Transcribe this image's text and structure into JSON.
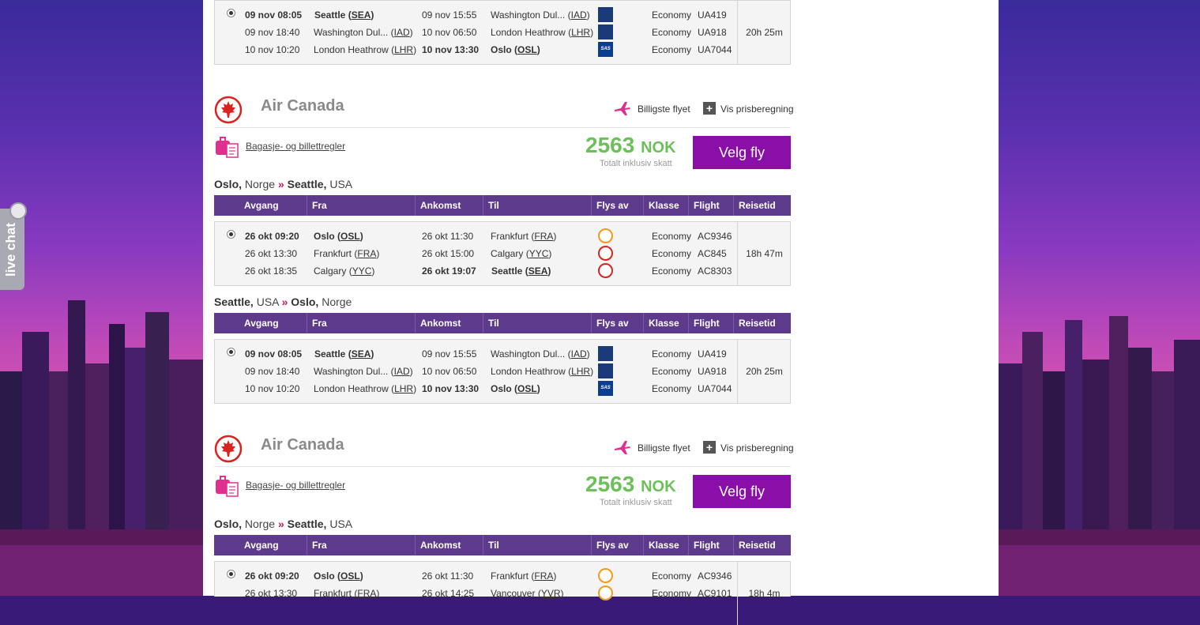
{
  "live_chat_label": "live chat",
  "header_labels": [
    "Avgang",
    "Fra",
    "Ankomst",
    "Til",
    "Flys av",
    "Klasse",
    "Flight",
    "Reisetid"
  ],
  "top_itinerary": {
    "duration": "20h 25m",
    "rows": [
      {
        "dep": "09 nov 08:05",
        "from": "Seattle",
        "from_code": "SEA",
        "arr": "09 nov 15:55",
        "to": "Washington Dul...",
        "to_code": "IAD",
        "carrier": "united-icon",
        "class": "Economy",
        "flight": "UA419",
        "bold_dep": true,
        "bold_arr": false
      },
      {
        "dep": "09 nov 18:40",
        "from": "Washington Dul...",
        "from_code": "IAD",
        "arr": "10 nov 06:50",
        "to": "London Heathrow",
        "to_code": "LHR",
        "carrier": "united-icon",
        "class": "Economy",
        "flight": "UA918",
        "bold_dep": false,
        "bold_arr": false
      },
      {
        "dep": "10 nov 10:20",
        "from": "London Heathrow",
        "from_code": "LHR",
        "arr": "10 nov 13:30",
        "to": "Oslo",
        "to_code": "OSL",
        "carrier": "sas-icon",
        "class": "Economy",
        "flight": "UA7044",
        "bold_dep": false,
        "bold_arr": true
      }
    ]
  },
  "offer1": {
    "airline": "Air Canada",
    "cheapest_label": "Billigste flyet",
    "show_price_label": "Vis prisberegning",
    "baggage_label": "Bagasje- og billettregler",
    "price": "2563",
    "currency": "NOK",
    "price_note": "Totalt inklusiv skatt",
    "select_label": "Velg fly",
    "out_route": {
      "from_city": "Oslo",
      "from_country": "Norge",
      "sep": "»",
      "to_city": "Seattle",
      "to_country": "USA"
    },
    "out_itinerary": {
      "duration": "18h 47m",
      "rows": [
        {
          "dep": "26 okt 09:20",
          "from": "Oslo",
          "from_code": "OSL",
          "arr": "26 okt 11:30",
          "to": "Frankfurt",
          "to_code": "FRA",
          "carrier": "lufthansa-icon",
          "class": "Economy",
          "flight": "AC9346",
          "bold_dep": true,
          "bold_arr": false
        },
        {
          "dep": "26 okt 13:30",
          "from": "Frankfurt",
          "from_code": "FRA",
          "arr": "26 okt 15:00",
          "to": "Calgary",
          "to_code": "YYC",
          "carrier": "air-canada-icon",
          "class": "Economy",
          "flight": "AC845",
          "bold_dep": false,
          "bold_arr": false
        },
        {
          "dep": "26 okt 18:35",
          "from": "Calgary",
          "from_code": "YYC",
          "arr": "26 okt 19:07",
          "to": "Seattle",
          "to_code": "SEA",
          "carrier": "air-canada-icon",
          "class": "Economy",
          "flight": "AC8303",
          "bold_dep": false,
          "bold_arr": true
        }
      ]
    },
    "ret_route": {
      "from_city": "Seattle",
      "from_country": "USA",
      "sep": "»",
      "to_city": "Oslo",
      "to_country": "Norge"
    },
    "ret_itinerary": {
      "duration": "20h 25m",
      "rows": [
        {
          "dep": "09 nov 08:05",
          "from": "Seattle",
          "from_code": "SEA",
          "arr": "09 nov 15:55",
          "to": "Washington Dul...",
          "to_code": "IAD",
          "carrier": "united-icon",
          "class": "Economy",
          "flight": "UA419",
          "bold_dep": true,
          "bold_arr": false
        },
        {
          "dep": "09 nov 18:40",
          "from": "Washington Dul...",
          "from_code": "IAD",
          "arr": "10 nov 06:50",
          "to": "London Heathrow",
          "to_code": "LHR",
          "carrier": "united-icon",
          "class": "Economy",
          "flight": "UA918",
          "bold_dep": false,
          "bold_arr": false
        },
        {
          "dep": "10 nov 10:20",
          "from": "London Heathrow",
          "from_code": "LHR",
          "arr": "10 nov 13:30",
          "to": "Oslo",
          "to_code": "OSL",
          "carrier": "sas-icon",
          "class": "Economy",
          "flight": "UA7044",
          "bold_dep": false,
          "bold_arr": true
        }
      ]
    }
  },
  "offer2": {
    "airline": "Air Canada",
    "cheapest_label": "Billigste flyet",
    "show_price_label": "Vis prisberegning",
    "baggage_label": "Bagasje- og billettregler",
    "price": "2563",
    "currency": "NOK",
    "price_note": "Totalt inklusiv skatt",
    "select_label": "Velg fly",
    "out_route": {
      "from_city": "Oslo",
      "from_country": "Norge",
      "sep": "»",
      "to_city": "Seattle",
      "to_country": "USA"
    },
    "out_itinerary": {
      "duration": "18h 4m",
      "rows": [
        {
          "dep": "26 okt 09:20",
          "from": "Oslo",
          "from_code": "OSL",
          "arr": "26 okt 11:30",
          "to": "Frankfurt",
          "to_code": "FRA",
          "carrier": "lufthansa-icon",
          "class": "Economy",
          "flight": "AC9346",
          "bold_dep": true,
          "bold_arr": false
        },
        {
          "dep": "26 okt 13:30",
          "from": "Frankfurt",
          "from_code": "FRA",
          "arr": "26 okt 14:25",
          "to": "Vancouver",
          "to_code": "YVR",
          "carrier": "lufthansa-icon",
          "class": "Economy",
          "flight": "AC9101",
          "bold_dep": false,
          "bold_arr": false
        }
      ]
    }
  },
  "colors": {
    "header_purple": "#5e3a8c",
    "button_purple": "#8a0fa8",
    "price_green": "#6dbf5b",
    "accent_pink": "#e0308f",
    "air_canada_red": "#d8231f"
  }
}
